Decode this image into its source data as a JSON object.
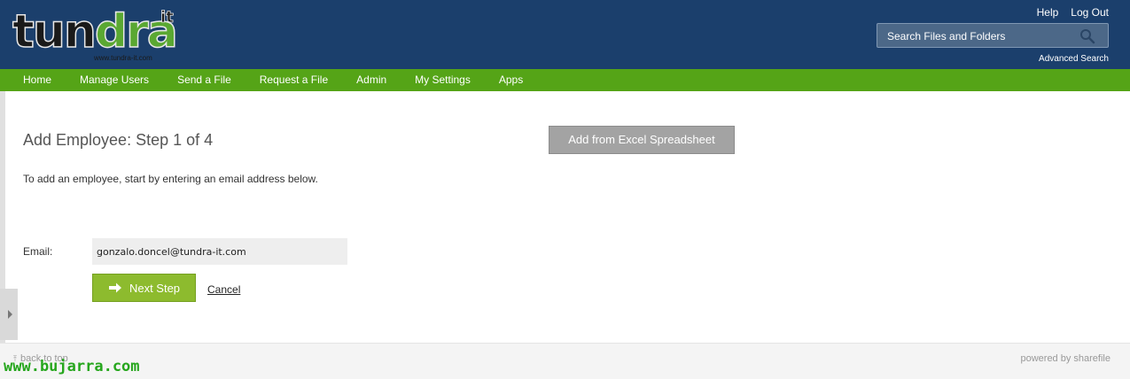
{
  "logo": {
    "main_prefix": "tun",
    "main_highlight": "dra",
    "superscript": "it",
    "url": "www.tundra-it.com"
  },
  "top_links": {
    "help": "Help",
    "logout": "Log Out"
  },
  "search": {
    "placeholder": "Search Files and Folders",
    "advanced": "Advanced Search",
    "icon": "search-icon"
  },
  "nav": [
    "Home",
    "Manage Users",
    "Send a File",
    "Request a File",
    "Admin",
    "My Settings",
    "Apps"
  ],
  "main": {
    "title": "Add Employee: Step 1 of 4",
    "excel_button": "Add from Excel Spreadsheet",
    "instruction": "To add an employee, start by entering an email address below.",
    "email_label": "Email:",
    "email_value": "gonzalo.doncel@tundra-it.com",
    "next_button": "Next Step",
    "cancel": "Cancel"
  },
  "footer": {
    "back_to_top": "back to top",
    "powered_by": "powered by sharefile"
  },
  "watermark": "www.bujarra.com",
  "colors": {
    "header": "#1b3f6c",
    "nav": "#55a417",
    "next_button": "#8dbb2e",
    "excel_button": "#a3a3a3",
    "watermark": "#26a61d"
  }
}
